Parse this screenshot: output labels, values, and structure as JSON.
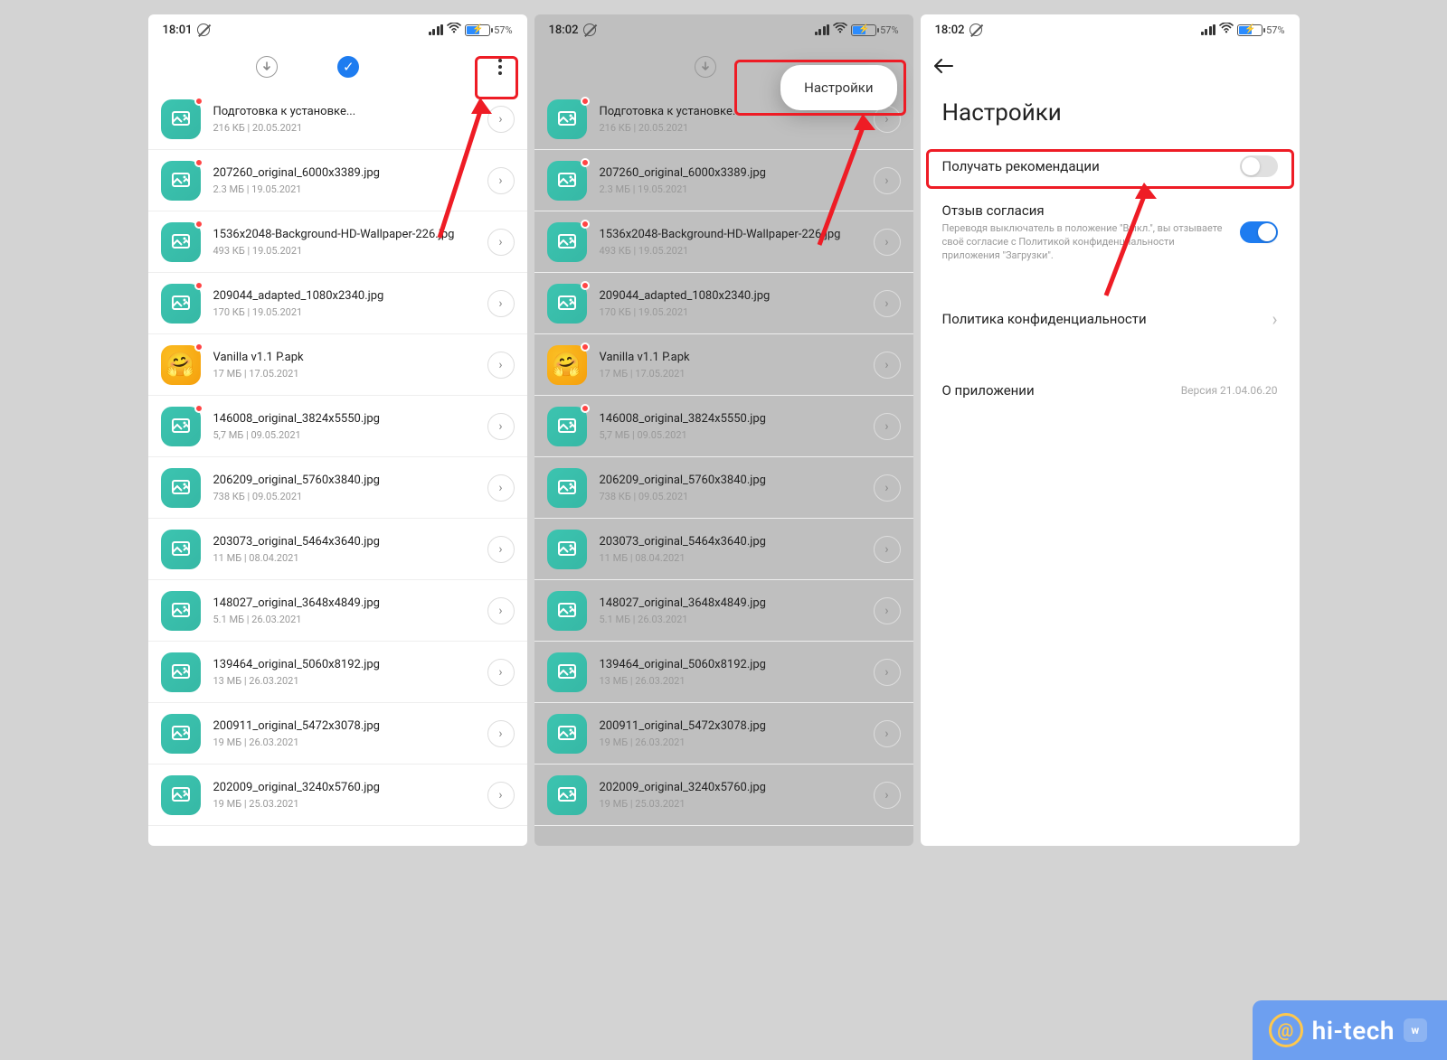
{
  "status": {
    "time_1": "18:01",
    "time_2": "18:02",
    "time_3": "18:02",
    "battery_pct": "57%"
  },
  "popup": {
    "settings_label": "Настройки"
  },
  "downloads": [
    {
      "name": "Подготовка к установке...",
      "meta": "216 КБ | 20.05.2021",
      "type": "image",
      "new": true
    },
    {
      "name": "207260_original_6000x3389.jpg",
      "meta": "2.3 МБ | 19.05.2021",
      "type": "image",
      "new": true
    },
    {
      "name": "1536x2048-Background-HD-Wallpaper-226.jpg",
      "meta": "493 КБ | 19.05.2021",
      "type": "image",
      "new": true
    },
    {
      "name": "209044_adapted_1080x2340.jpg",
      "meta": "170 КБ | 19.05.2021",
      "type": "image",
      "new": true
    },
    {
      "name": "Vanilla v1.1 P.apk",
      "meta": "17 МБ | 17.05.2021",
      "type": "apk",
      "new": true
    },
    {
      "name": "146008_original_3824x5550.jpg",
      "meta": "5,7 МБ | 09.05.2021",
      "type": "image",
      "new": true
    },
    {
      "name": "206209_original_5760x3840.jpg",
      "meta": "738 КБ | 09.05.2021",
      "type": "image",
      "new": false
    },
    {
      "name": "203073_original_5464x3640.jpg",
      "meta": "11 МБ | 08.04.2021",
      "type": "image",
      "new": false
    },
    {
      "name": "148027_original_3648x4849.jpg",
      "meta": "5.1 МБ | 26.03.2021",
      "type": "image",
      "new": false
    },
    {
      "name": "139464_original_5060x8192.jpg",
      "meta": "13 МБ | 26.03.2021",
      "type": "image",
      "new": false
    },
    {
      "name": "200911_original_5472x3078.jpg",
      "meta": "19 МБ | 26.03.2021",
      "type": "image",
      "new": false
    },
    {
      "name": "202009_original_3240x5760.jpg",
      "meta": "19 МБ | 25.03.2021",
      "type": "image",
      "new": false
    }
  ],
  "settings": {
    "title": "Настройки",
    "recommend_label": "Получать рекомендации",
    "consent_label": "Отзыв согласия",
    "consent_sub": "Переводя выключатель в положение \"Выкл.\", вы отзываете своё согласие с Политикой конфиденциальности приложения \"Загрузки\".",
    "privacy_label": "Политика конфиденциальности",
    "about_label": "О приложении",
    "version": "Версия 21.04.06.20"
  },
  "watermark": {
    "text": "hi-tech"
  }
}
